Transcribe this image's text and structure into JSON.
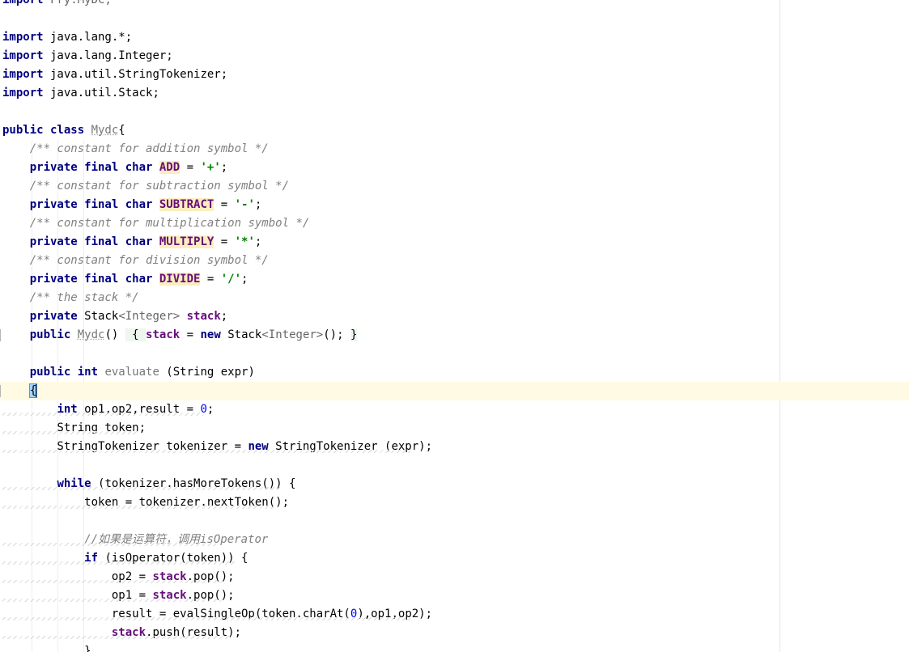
{
  "editor": {
    "lines": [
      {
        "tokens": [
          {
            "t": "import",
            "c": "kw"
          },
          {
            "t": " Fry.MyDC;",
            "c": "gen"
          }
        ]
      },
      {
        "tokens": []
      },
      {
        "tokens": [
          {
            "t": "import",
            "c": "kw"
          },
          {
            "t": " java.lang.*;"
          }
        ]
      },
      {
        "tokens": [
          {
            "t": "import",
            "c": "kw"
          },
          {
            "t": " java.lang.Integer;"
          }
        ]
      },
      {
        "tokens": [
          {
            "t": "import",
            "c": "kw"
          },
          {
            "t": " java.util.StringTokenizer;"
          }
        ]
      },
      {
        "tokens": [
          {
            "t": "import",
            "c": "kw"
          },
          {
            "t": " java.util.Stack;"
          }
        ]
      },
      {
        "tokens": []
      },
      {
        "tokens": [
          {
            "t": "public class ",
            "c": "kw"
          },
          {
            "t": "Mydc",
            "c": "usl"
          },
          {
            "t": "{"
          }
        ]
      },
      {
        "tokens": [
          {
            "t": "    "
          },
          {
            "t": "/** constant for addition symbol */",
            "c": "doc"
          }
        ]
      },
      {
        "tokens": [
          {
            "t": "    "
          },
          {
            "t": "private final char ",
            "c": "kw"
          },
          {
            "t": "ADD",
            "c": "cst"
          },
          {
            "t": " = "
          },
          {
            "t": "'+'",
            "c": "str"
          },
          {
            "t": ";"
          }
        ]
      },
      {
        "tokens": [
          {
            "t": "    "
          },
          {
            "t": "/** constant for subtraction symbol */",
            "c": "doc"
          }
        ]
      },
      {
        "tokens": [
          {
            "t": "    "
          },
          {
            "t": "private final char ",
            "c": "kw"
          },
          {
            "t": "SUBTRACT",
            "c": "cst"
          },
          {
            "t": " = "
          },
          {
            "t": "'-'",
            "c": "str"
          },
          {
            "t": ";"
          }
        ]
      },
      {
        "tokens": [
          {
            "t": "    "
          },
          {
            "t": "/** constant for multiplication symbol */",
            "c": "doc"
          }
        ]
      },
      {
        "tokens": [
          {
            "t": "    "
          },
          {
            "t": "private final char ",
            "c": "kw"
          },
          {
            "t": "MULTIPLY",
            "c": "cst"
          },
          {
            "t": " = "
          },
          {
            "t": "'*'",
            "c": "str"
          },
          {
            "t": ";"
          }
        ]
      },
      {
        "tokens": [
          {
            "t": "    "
          },
          {
            "t": "/** constant for division symbol */",
            "c": "doc"
          }
        ]
      },
      {
        "tokens": [
          {
            "t": "    "
          },
          {
            "t": "private final char ",
            "c": "kw"
          },
          {
            "t": "DIVIDE",
            "c": "cst"
          },
          {
            "t": " = "
          },
          {
            "t": "'/'",
            "c": "str"
          },
          {
            "t": ";"
          }
        ]
      },
      {
        "tokens": [
          {
            "t": "    "
          },
          {
            "t": "/** the stack */",
            "c": "doc"
          }
        ]
      },
      {
        "tokens": [
          {
            "t": "    "
          },
          {
            "t": "private ",
            "c": "kw"
          },
          {
            "t": "Stack"
          },
          {
            "t": "<Integer> ",
            "c": "gen"
          },
          {
            "t": "stack",
            "c": "fld"
          },
          {
            "t": ";"
          }
        ]
      },
      {
        "tokens": [
          {
            "t": "    "
          },
          {
            "t": "public ",
            "c": "kw"
          },
          {
            "t": "Mydc",
            "c": "usl"
          },
          {
            "t": "() "
          },
          {
            "t": " { ",
            "c": "fold"
          },
          {
            "t": "stack",
            "c": "fld"
          },
          {
            "t": " = "
          },
          {
            "t": "new ",
            "c": "kw"
          },
          {
            "t": "Stack"
          },
          {
            "t": "<Integer>",
            "c": "gen"
          },
          {
            "t": "(); "
          },
          {
            "t": "}",
            "c": "fold"
          }
        ]
      },
      {
        "tokens": []
      },
      {
        "tokens": [
          {
            "t": "    "
          },
          {
            "t": "public int ",
            "c": "kw"
          },
          {
            "t": "evaluate",
            "c": "mth"
          },
          {
            "t": " (String expr)"
          }
        ]
      },
      {
        "tokens": [
          {
            "t": "    "
          },
          {
            "t": "{",
            "c": "brace-hl"
          },
          {
            "t": "",
            "c": "caret"
          }
        ],
        "current": true
      },
      {
        "tokens": [
          {
            "t": "        "
          },
          {
            "t": "int ",
            "c": "kw"
          },
          {
            "t": "op1,op2,result = "
          },
          {
            "t": "0",
            "c": "num"
          },
          {
            "t": ";"
          }
        ],
        "warn": true
      },
      {
        "tokens": [
          {
            "t": "        String token;"
          }
        ],
        "warn": true
      },
      {
        "tokens": [
          {
            "t": "        StringTokenizer tokenizer = "
          },
          {
            "t": "new ",
            "c": "kw"
          },
          {
            "t": "StringTokenizer (expr);"
          }
        ],
        "warn": true
      },
      {
        "tokens": []
      },
      {
        "tokens": [
          {
            "t": "        "
          },
          {
            "t": "while",
            "c": "kw"
          },
          {
            "t": " (tokenizer.hasMoreTokens()) {"
          }
        ],
        "warn": true
      },
      {
        "tokens": [
          {
            "t": "            token = tokenizer.nextToken();"
          }
        ],
        "warn": true
      },
      {
        "tokens": []
      },
      {
        "tokens": [
          {
            "t": "            "
          },
          {
            "t": "//如果是运算符，调用isOperator",
            "c": "cm"
          }
        ],
        "warn": true
      },
      {
        "tokens": [
          {
            "t": "            "
          },
          {
            "t": "if",
            "c": "kw"
          },
          {
            "t": " (isOperator(token)) {"
          }
        ],
        "warn": true
      },
      {
        "tokens": [
          {
            "t": "                op2 = "
          },
          {
            "t": "stack",
            "c": "fld"
          },
          {
            "t": ".pop();"
          }
        ],
        "warn": true
      },
      {
        "tokens": [
          {
            "t": "                op1 = "
          },
          {
            "t": "stack",
            "c": "fld"
          },
          {
            "t": ".pop();"
          }
        ],
        "warn": true
      },
      {
        "tokens": [
          {
            "t": "                result = evalSingleOp(token.charAt("
          },
          {
            "t": "0",
            "c": "num"
          },
          {
            "t": "),op1,op2);"
          }
        ],
        "warn": true
      },
      {
        "tokens": [
          {
            "t": "                "
          },
          {
            "t": "stack",
            "c": "fld"
          },
          {
            "t": ".push(result);"
          }
        ],
        "warn": true
      },
      {
        "tokens": [
          {
            "t": "            }"
          }
        ]
      }
    ]
  }
}
